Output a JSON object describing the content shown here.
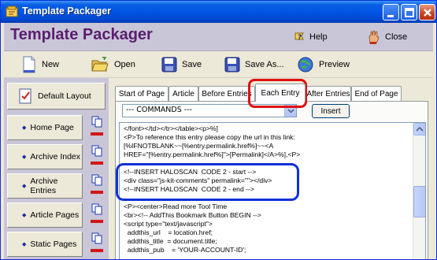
{
  "window": {
    "title": "Template Packager"
  },
  "header": {
    "title": "Template Packager",
    "help_label": "Help",
    "close_label": "Close"
  },
  "toolbar": {
    "new_label": "New",
    "open_label": "Open",
    "save_label": "Save",
    "save_as_label": "Save As...",
    "preview_label": "Preview"
  },
  "sidebar": {
    "default_layout_label": "Default Layout",
    "items": [
      {
        "label": "Home Page"
      },
      {
        "label": "Archive Index"
      },
      {
        "label": "Archive Entries"
      },
      {
        "label": "Article Pages"
      },
      {
        "label": "Static Pages"
      }
    ]
  },
  "tabs": [
    {
      "label": "Start of Page"
    },
    {
      "label": "Article"
    },
    {
      "label": "Before Entries"
    },
    {
      "label": "Each Entry"
    },
    {
      "label": "After Entries"
    },
    {
      "label": "End of Page"
    }
  ],
  "active_tab": "Each Entry",
  "commands": {
    "selected": "--- COMMANDS ---",
    "insert_label": "Insert"
  },
  "editor": {
    "lines": [
      "</font></td></tr></table><p>%]",
      "<P>To reference this entry please copy the url in this link:",
      "[%IFNOTBLANK~~[%entry.permalink.href%]~~<A",
      "HREF=\"[%entry.permalink.href%]\">[Permalink]</A>%],<P>",
      "",
      "<!--INSERT HALOSCAN  CODE 2 - start -->",
      "<div class=\"js-kit-comments\" permalink=\"\"></div>",
      "<!--INSERT HALOSCAN  CODE 2 - end -->",
      "",
      "<P><center>Read more Tool Time",
      "<br><!-- AddThis Bookmark Button BEGIN -->",
      "<script type=\"text/javascript\">",
      "  addthis_url    = location.href;",
      "  addthis_title  = document.title;",
      "  addthis_pub    = 'YOUR-ACCOUNT-ID';"
    ]
  },
  "colors": {
    "title_purple": "#5b1e6e",
    "highlight_red": "#e01010",
    "highlight_blue": "#1030d8",
    "titlebar_blue": "#0055e5"
  }
}
